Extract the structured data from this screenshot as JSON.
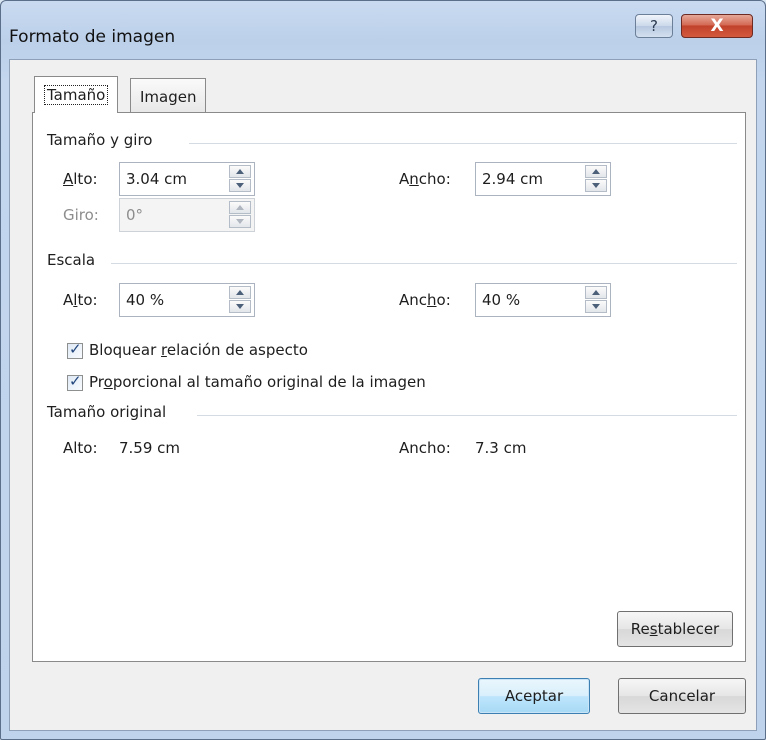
{
  "window": {
    "title": "Formato de imagen",
    "help": "?",
    "close": "X"
  },
  "tabs": [
    {
      "label": "Tamaño",
      "active": true
    },
    {
      "label": "Imagen",
      "active": false
    }
  ],
  "size_rotation": {
    "heading": "Tamaño y giro",
    "height_label_pre": "",
    "height_label_ul": "A",
    "height_label_post": "lto:",
    "height_value": "3.04 cm",
    "width_label_pre": "A",
    "width_label_ul": "n",
    "width_label_post": "cho:",
    "width_value": "2.94 cm",
    "rotation_label": "Giro:",
    "rotation_value": "0°"
  },
  "scale": {
    "heading": "Escala",
    "height_label_pre": "A",
    "height_label_ul": "l",
    "height_label_post": "to:",
    "height_value": "40 %",
    "width_label_pre": "Anc",
    "width_label_ul": "h",
    "width_label_post": "o:",
    "width_value": "40 %",
    "lock_aspect_pre": "Bloquear ",
    "lock_aspect_ul": "r",
    "lock_aspect_post": "elación de aspecto",
    "lock_aspect_checked": true,
    "relative_pre": "Pr",
    "relative_ul": "o",
    "relative_post": "porcional al tamaño original de la imagen",
    "relative_checked": true
  },
  "original_size": {
    "heading": "Tamaño original",
    "height_label": "Alto:",
    "height_value": "7.59 cm",
    "width_label": "Ancho:",
    "width_value": "7.3 cm"
  },
  "buttons": {
    "reset_pre": "Re",
    "reset_ul": "s",
    "reset_post": "tablecer",
    "ok": "Aceptar",
    "cancel": "Cancelar"
  }
}
